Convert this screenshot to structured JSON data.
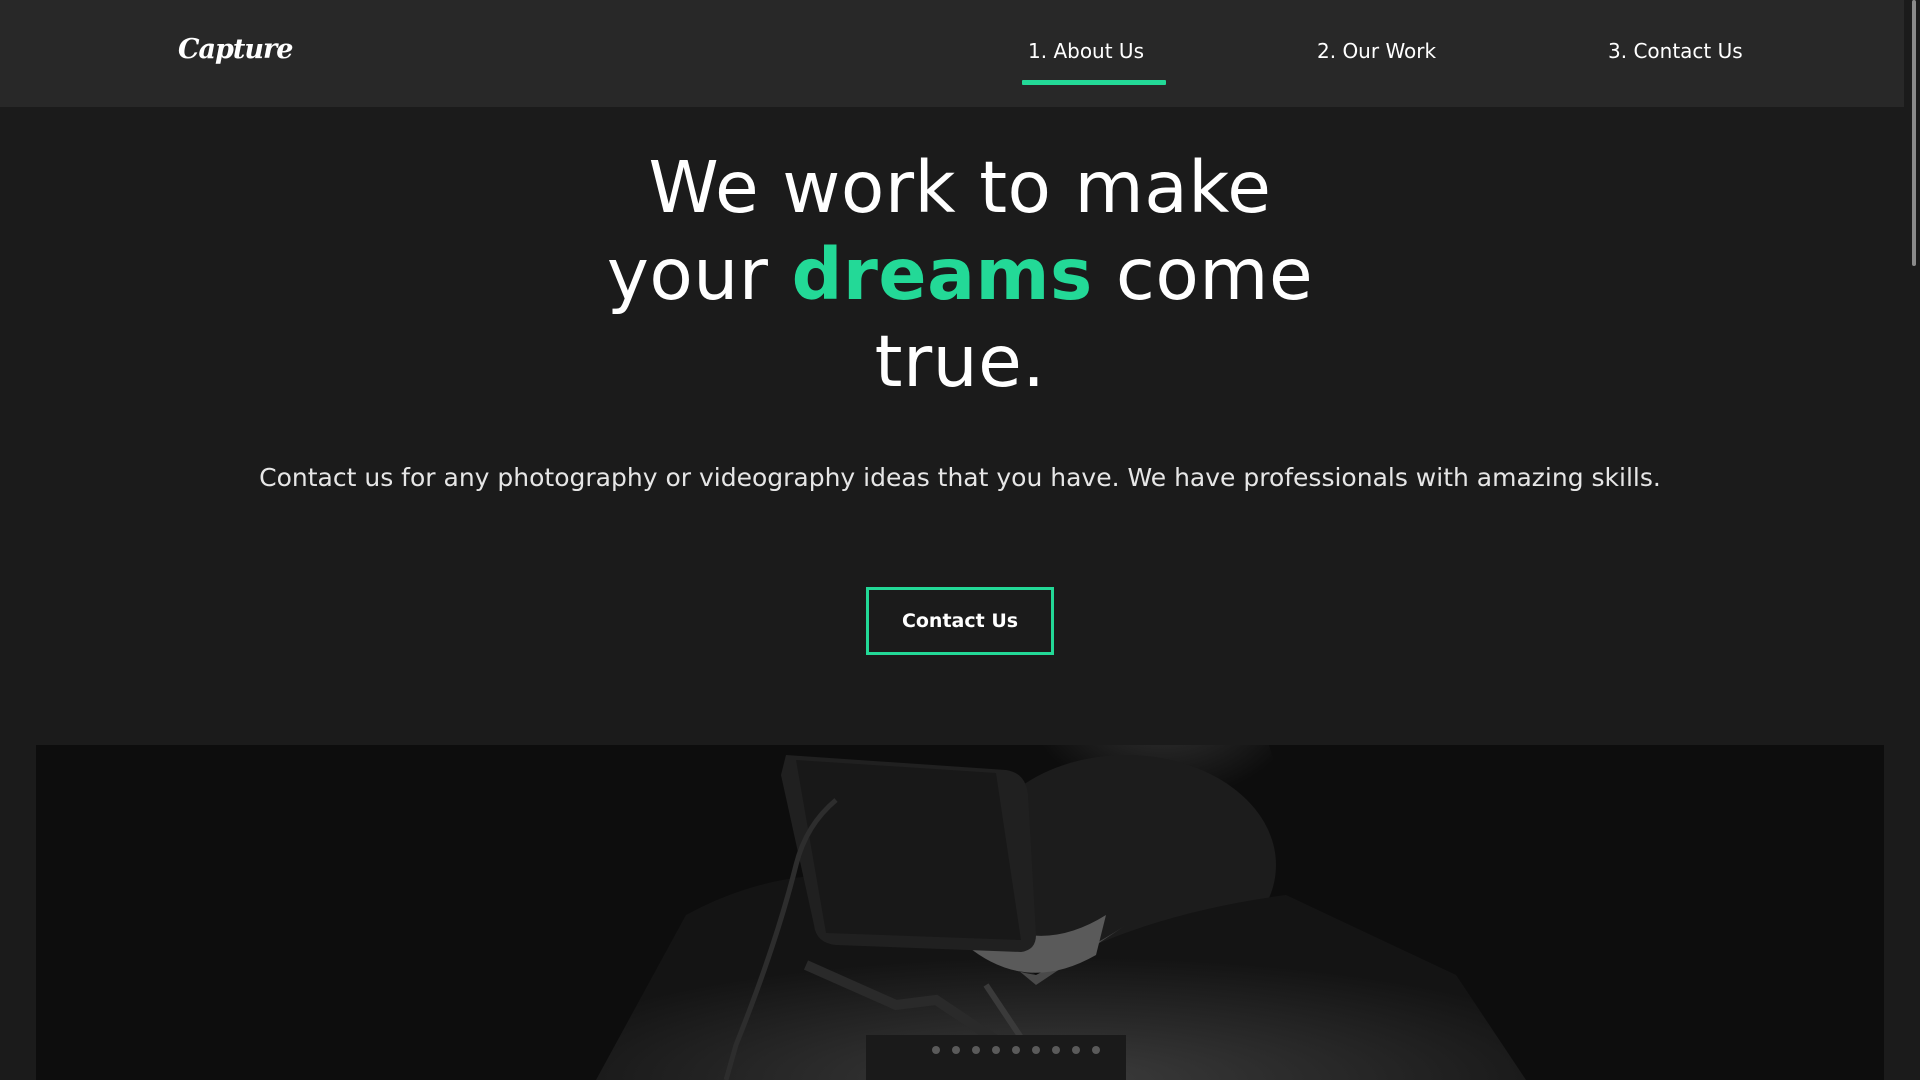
{
  "brand": {
    "logo_text": "Capture"
  },
  "nav": {
    "items": [
      {
        "label": "1. About Us",
        "active": true
      },
      {
        "label": "2. Our Work",
        "active": false
      },
      {
        "label": "3. Contact Us",
        "active": false
      }
    ]
  },
  "hero": {
    "headline_part1": "We work to make your",
    "headline_accent": "dreams",
    "headline_part2": "come true.",
    "subtitle": "Contact us for any photography or videography ideas that you have. We have professionals with amazing skills.",
    "cta_label": "Contact Us"
  },
  "colors": {
    "accent": "#23d997",
    "background": "#1b1b1b",
    "navbar": "#282828"
  }
}
